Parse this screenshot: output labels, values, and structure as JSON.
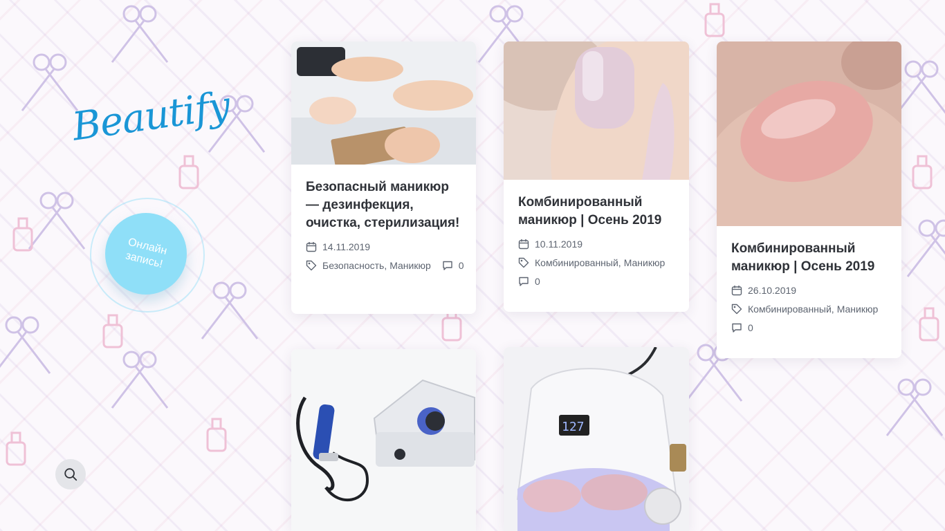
{
  "site": {
    "logo_text": "Beautify",
    "booking_label": "Онлайн\nзапись!",
    "search_icon": "search-icon",
    "colors": {
      "logo": "#1a96d6",
      "booking": "#8fdff8",
      "title": "#2f3238",
      "meta": "#5d6470"
    }
  },
  "posts": [
    {
      "title": "Безопасный маникюр — дезинфекция, очистка, стерилизация!",
      "date": "14.11.2019",
      "tags": [
        "Безопасность",
        "Маникюр"
      ],
      "comments": "0",
      "image": "manicure procedure with sterile kraft pouch"
    },
    {
      "title": "Комбинированный маникюр | Осень 2019",
      "date": "10.11.2019",
      "tags": [
        "Комбинированный",
        "Маникюр"
      ],
      "comments": "0",
      "image": "lilac nude nail polish close-up"
    },
    {
      "title": "Комбинированный маникюр | Осень 2019",
      "date": "26.10.2019",
      "tags": [
        "Комбинированный",
        "Маникюр"
      ],
      "comments": "0",
      "image": "pink nude nail close-up"
    },
    {
      "image": "nail drill machine"
    },
    {
      "image": "uv lamp with hands"
    }
  ]
}
